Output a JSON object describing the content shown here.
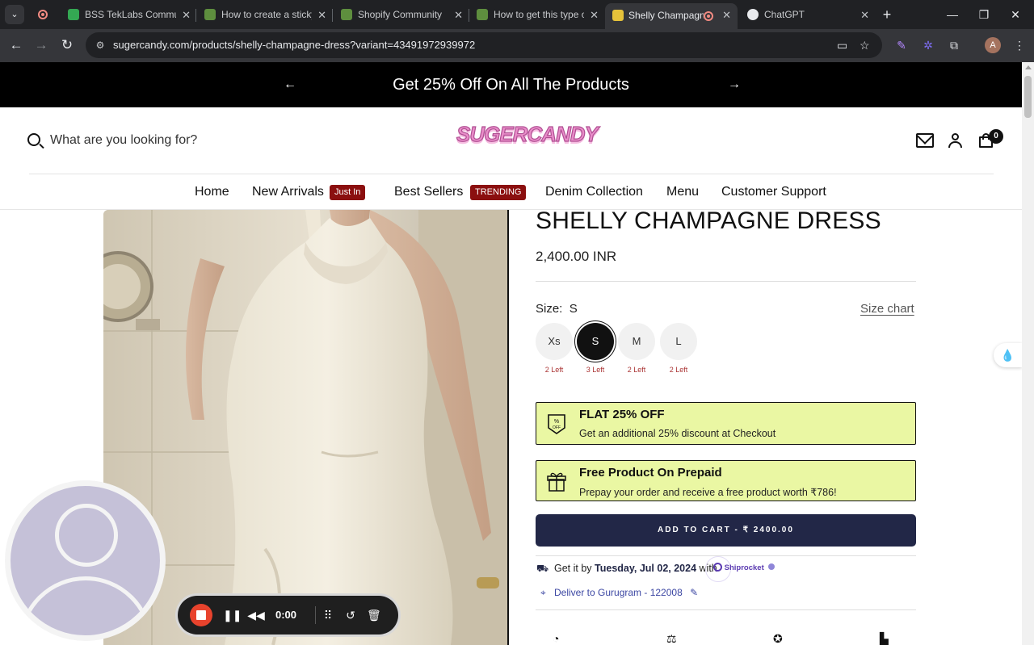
{
  "browser": {
    "tabs": [
      {
        "title": "BSS TekLabs Community",
        "favicon_color": "#34a853"
      },
      {
        "title": "How to create a sticky",
        "favicon_color": "#5e8e3e"
      },
      {
        "title": "Shopify Community",
        "favicon_color": "#5e8e3e"
      },
      {
        "title": "How to get this type of",
        "favicon_color": "#5e8e3e"
      },
      {
        "title": "Shelly Champagne",
        "favicon_color": "#e6c23a"
      },
      {
        "title": "ChatGPT",
        "favicon_color": "#e8eaed"
      }
    ],
    "active_tab_index": 4,
    "new_tab_label": "+",
    "window_controls": {
      "minimize": "—",
      "restore": "❐",
      "close": "✕"
    },
    "url": "sugercandy.com/products/shelly-champagne-dress?variant=43491972939972",
    "profile_initial": "A",
    "icons": [
      "back-icon",
      "forward-icon",
      "reload-icon",
      "site-info-icon",
      "camera-icon",
      "star-icon",
      "extensions-icon"
    ]
  },
  "announcement": {
    "text": "Get 25% Off On All The Products",
    "prev_arrow": "←",
    "next_arrow": "→"
  },
  "header": {
    "search_placeholder": "What are you looking for?",
    "logo_text": "SUGERCANDY",
    "cart_count": "0"
  },
  "nav": {
    "items": [
      {
        "label": "Home"
      },
      {
        "label": "New Arrivals",
        "badge": "Just In"
      },
      {
        "label": "Best Sellers",
        "badge": "TRENDING"
      },
      {
        "label": "Denim Collection"
      },
      {
        "label": "Menu"
      },
      {
        "label": "Customer Support"
      }
    ],
    "badge_color": "#8b0f0f"
  },
  "product": {
    "title": "SHELLY CHAMPAGNE DRESS",
    "price": "2,400.00 INR",
    "size_label": "Size:",
    "size_selected": "S",
    "size_chart": "Size chart",
    "sizes": [
      {
        "label": "Xs",
        "stock": "2 Left"
      },
      {
        "label": "S",
        "stock": "3 Left"
      },
      {
        "label": "M",
        "stock": "2 Left"
      },
      {
        "label": "L",
        "stock": "2 Left"
      }
    ],
    "promos": [
      {
        "title": "FLAT 25% OFF",
        "subtitle": "Get an additional 25% discount at Checkout",
        "icon": "discount-tag-icon"
      },
      {
        "title": "Free Product On Prepaid",
        "subtitle": "Prepay your order and receive a free product worth ₹786!",
        "icon": "gift-icon"
      }
    ],
    "promo_color": "#eaf7a3",
    "add_to_cart": "ADD TO CART - ₹ 2400.00",
    "add_to_cart_color": "#222747",
    "delivery_prefix": "Get it by",
    "delivery_date": "Tuesday, Jul 02, 2024",
    "delivery_with": "with",
    "courier": "Shiprocket",
    "deliver_to": "Deliver to Gurugram - 122008"
  },
  "recorder": {
    "time": "0:00",
    "icons": [
      "stop-icon",
      "pause-icon",
      "rewind-icon",
      "grid-icon",
      "restart-icon",
      "trash-icon"
    ]
  }
}
